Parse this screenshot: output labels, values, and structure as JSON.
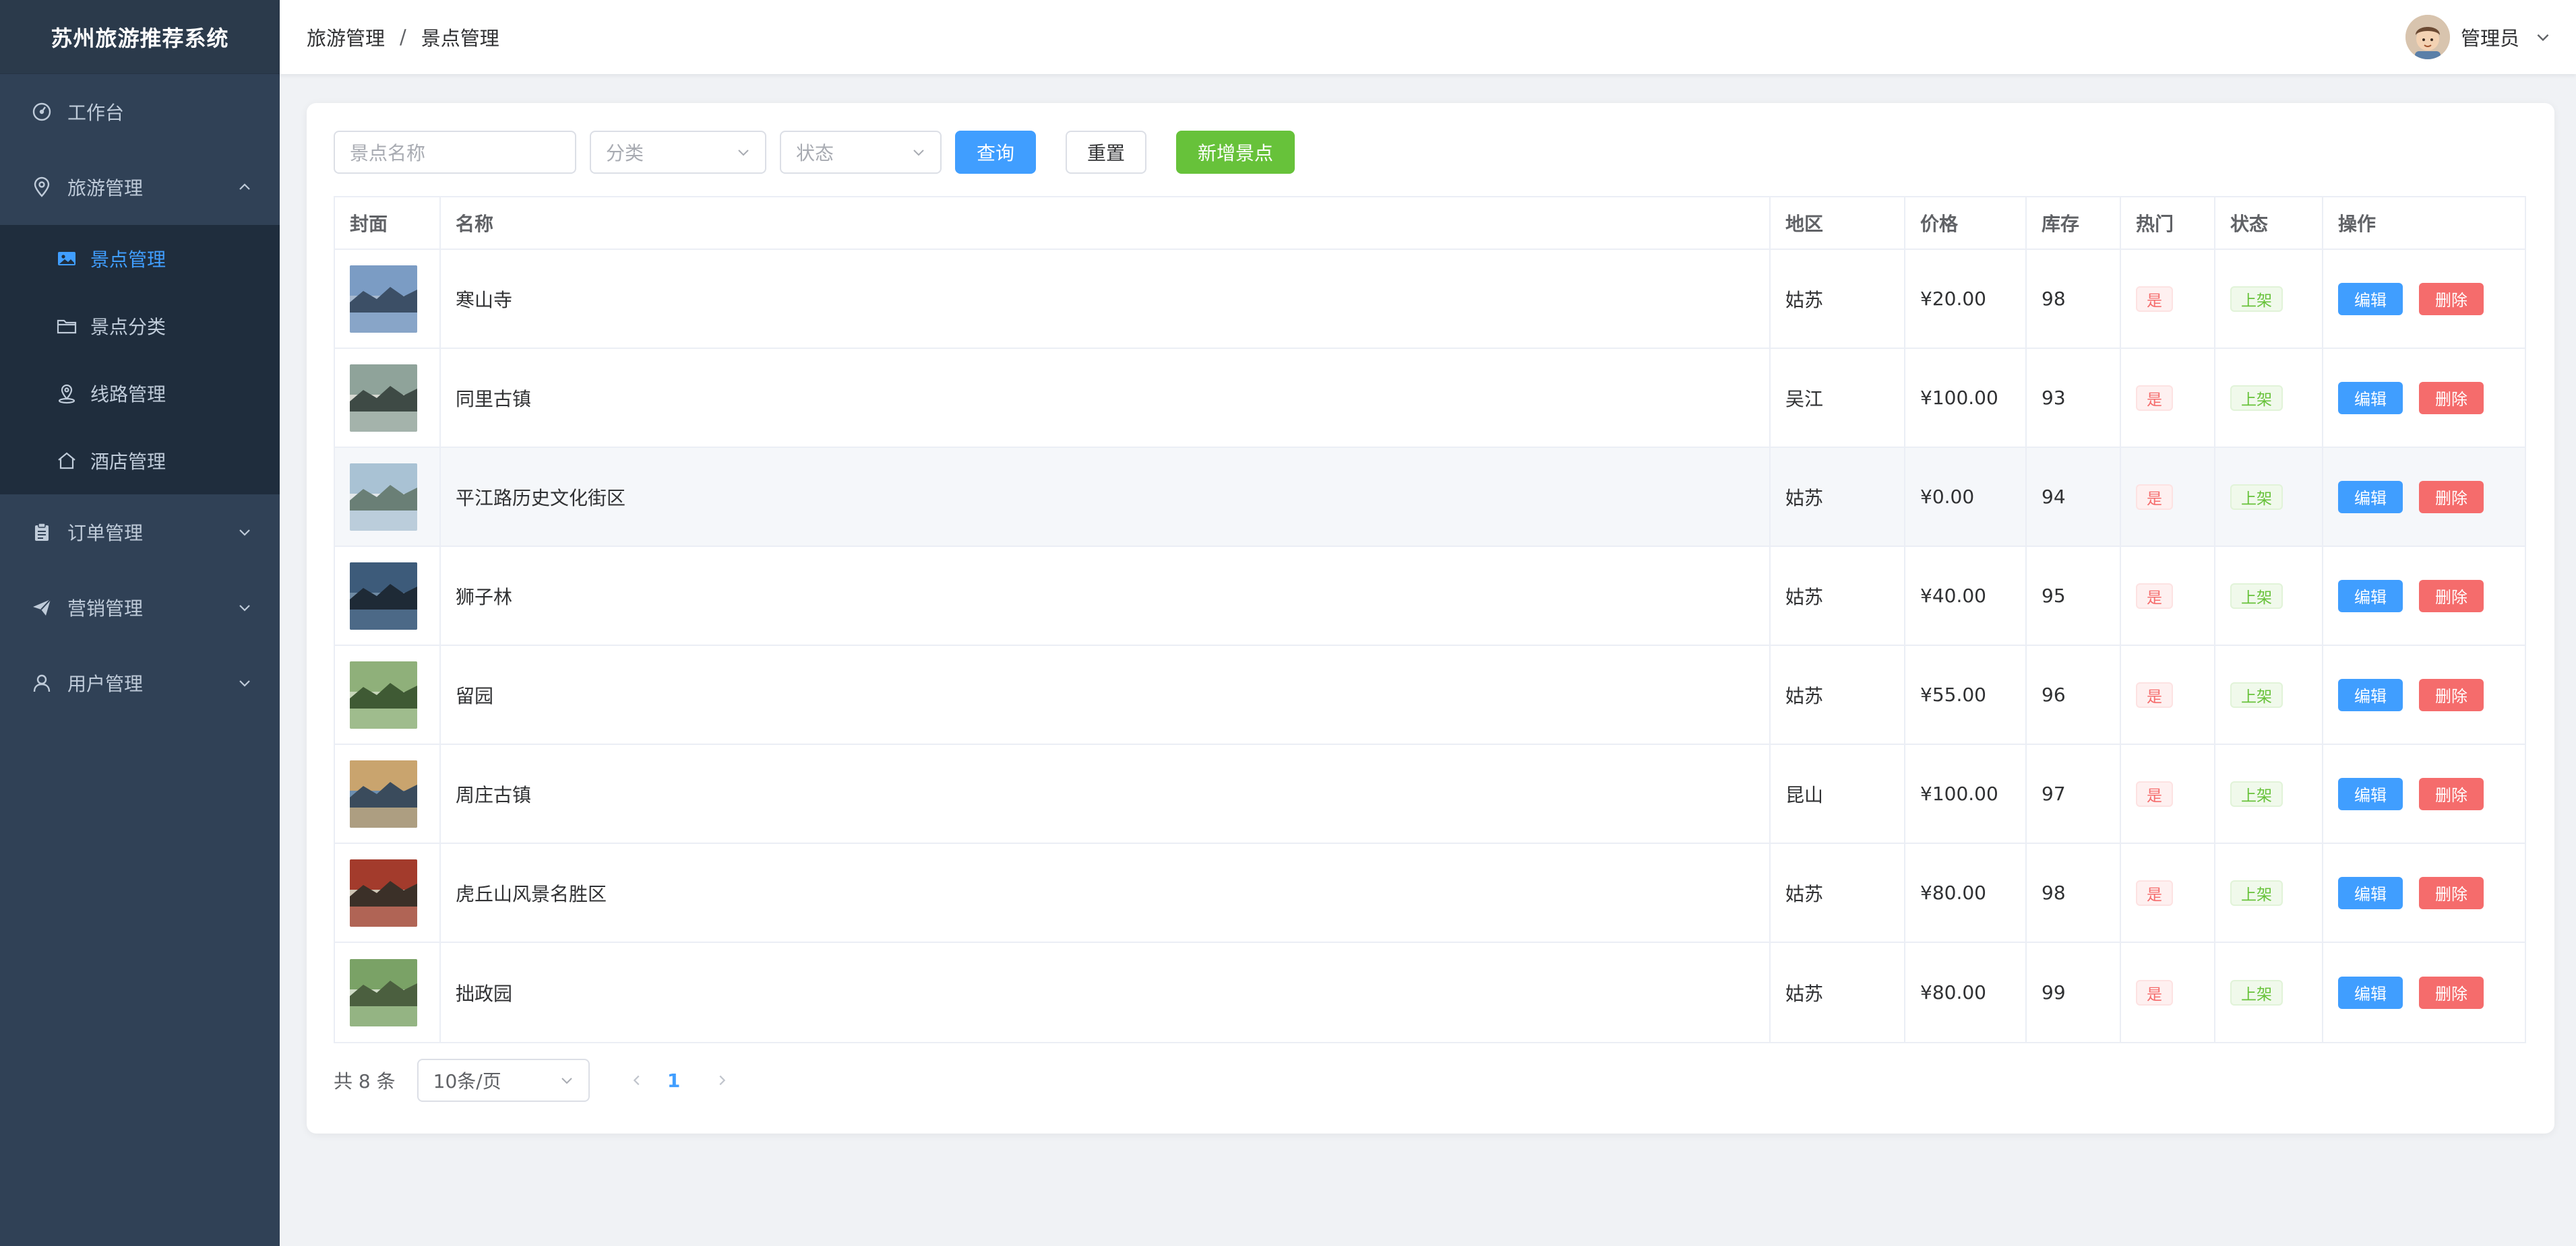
{
  "app": {
    "title": "苏州旅游推荐系统"
  },
  "sidebar": {
    "items": [
      {
        "label": "工作台",
        "icon": "dashboard-icon"
      },
      {
        "label": "旅游管理",
        "icon": "location-icon",
        "expanded": true,
        "children": [
          {
            "label": "景点管理",
            "icon": "picture-icon",
            "active": true
          },
          {
            "label": "景点分类",
            "icon": "folder-icon"
          },
          {
            "label": "线路管理",
            "icon": "route-pin-icon"
          },
          {
            "label": "酒店管理",
            "icon": "house-icon"
          }
        ]
      },
      {
        "label": "订单管理",
        "icon": "clipboard-icon"
      },
      {
        "label": "营销管理",
        "icon": "paper-plane-icon"
      },
      {
        "label": "用户管理",
        "icon": "user-icon"
      }
    ]
  },
  "header": {
    "breadcrumb": [
      "旅游管理",
      "景点管理"
    ],
    "separator": "/",
    "user": "管理员"
  },
  "filters": {
    "name_placeholder": "景点名称",
    "category_placeholder": "分类",
    "status_placeholder": "状态",
    "query_label": "查询",
    "reset_label": "重置",
    "add_label": "新增景点"
  },
  "table": {
    "columns": [
      "封面",
      "名称",
      "地区",
      "价格",
      "库存",
      "热门",
      "状态",
      "操作"
    ],
    "rows": [
      {
        "name": "寒山寺",
        "area": "姑苏",
        "price": "¥20.00",
        "stock": "98",
        "hot": "是",
        "status": "上架"
      },
      {
        "name": "同里古镇",
        "area": "吴江",
        "price": "¥100.00",
        "stock": "93",
        "hot": "是",
        "status": "上架"
      },
      {
        "name": "平江路历史文化街区",
        "area": "姑苏",
        "price": "¥0.00",
        "stock": "94",
        "hot": "是",
        "status": "上架"
      },
      {
        "name": "狮子林",
        "area": "姑苏",
        "price": "¥40.00",
        "stock": "95",
        "hot": "是",
        "status": "上架"
      },
      {
        "name": "留园",
        "area": "姑苏",
        "price": "¥55.00",
        "stock": "96",
        "hot": "是",
        "status": "上架"
      },
      {
        "name": "周庄古镇",
        "area": "昆山",
        "price": "¥100.00",
        "stock": "97",
        "hot": "是",
        "status": "上架"
      },
      {
        "name": "虎丘山风景名胜区",
        "area": "姑苏",
        "price": "¥80.00",
        "stock": "98",
        "hot": "是",
        "status": "上架"
      },
      {
        "name": "拙政园",
        "area": "姑苏",
        "price": "¥80.00",
        "stock": "99",
        "hot": "是",
        "status": "上架"
      }
    ],
    "edit_label": "编辑",
    "delete_label": "删除"
  },
  "pagination": {
    "total_text": "共 8 条",
    "page_size": "10条/页",
    "current_page": "1"
  },
  "colors": {
    "sidebar_bg": "#304156",
    "accent": "#409eff",
    "success": "#67c23a",
    "danger": "#f56c6c"
  }
}
